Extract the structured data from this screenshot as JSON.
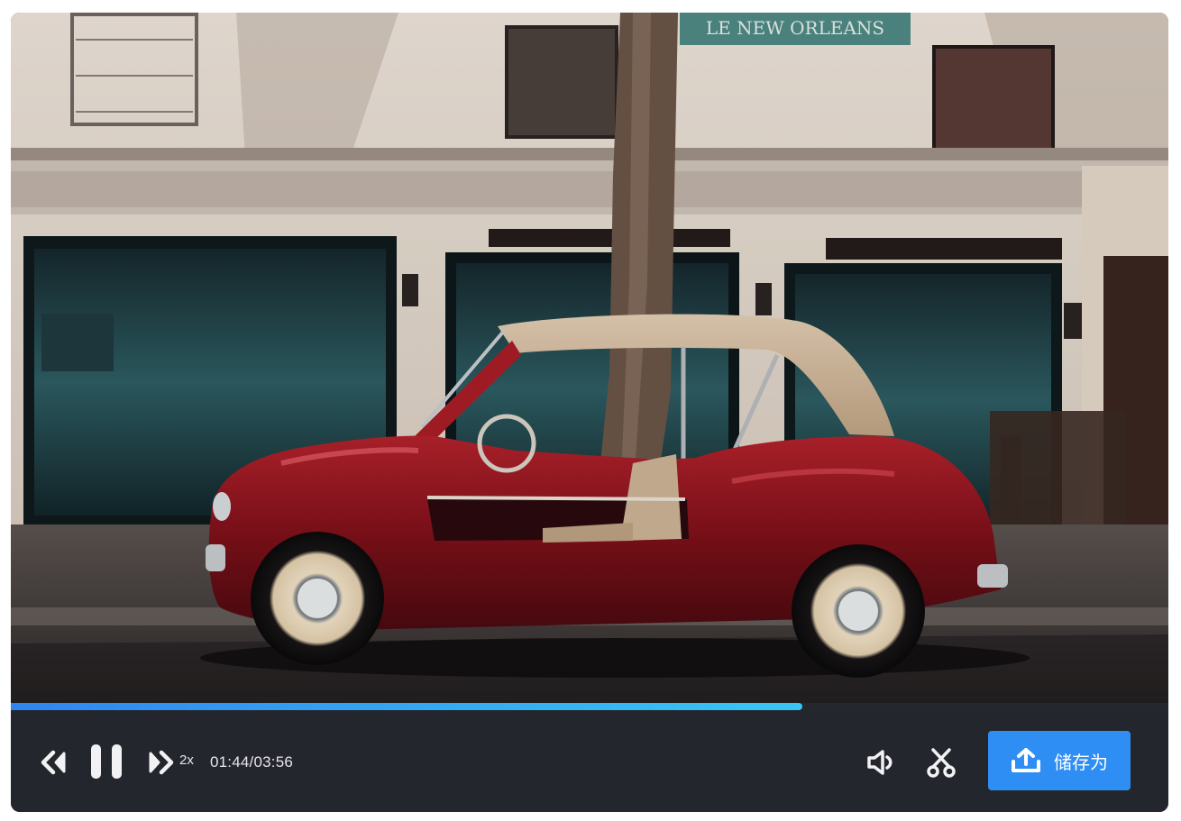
{
  "player": {
    "progress_fraction": 0.684,
    "playback_rate": "2x",
    "time_current": "01:44",
    "time_separator": "/",
    "time_total": "03:56",
    "save_label": "储存为"
  },
  "video_scene": {
    "shop_sign_text": "LE NEW ORLEANS"
  },
  "colors": {
    "progress_start": "#2f86f2",
    "progress_end": "#37c7f4",
    "control_bar": "#24262d",
    "save_button": "#2f8ef4",
    "icon": "#f2f2f4"
  },
  "icons": {
    "rewind": "rewind-icon",
    "pause": "pause-icon",
    "forward": "fast-forward-icon",
    "volume": "volume-icon",
    "cut": "scissors-icon",
    "upload": "upload-icon"
  }
}
